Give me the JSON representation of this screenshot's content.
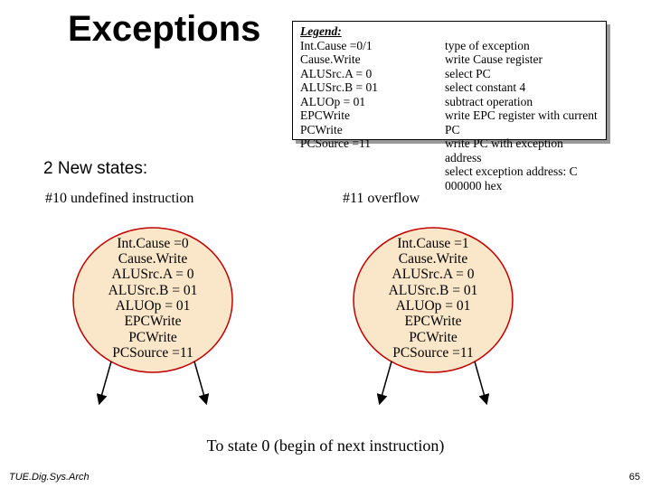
{
  "title": "Exceptions",
  "legend": {
    "heading": "Legend:",
    "items": [
      {
        "sig": "Int.Cause =0/1",
        "desc": "type of exception"
      },
      {
        "sig": "Cause.Write",
        "desc": "write Cause register"
      },
      {
        "sig": "ALUSrc.A = 0",
        "desc": "select PC"
      },
      {
        "sig": "ALUSrc.B = 01",
        "desc": "select constant 4"
      },
      {
        "sig": "ALUOp = 01",
        "desc": "subtract operation"
      },
      {
        "sig": "EPCWrite",
        "desc": "write EPC register with current PC"
      },
      {
        "sig": "PCWrite",
        "desc": "write PC with exception address"
      },
      {
        "sig": "PCSource =11",
        "desc": "select exception address: C 000000 hex"
      }
    ]
  },
  "subheader": "2 New states:",
  "states": [
    {
      "label": "#10 undefined instruction",
      "lines": [
        "Int.Cause =0",
        "Cause.Write",
        "ALUSrc.A = 0",
        "ALUSrc.B = 01",
        "ALUOp = 01",
        "EPCWrite",
        "PCWrite",
        "PCSource =11"
      ]
    },
    {
      "label": "#11 overflow",
      "lines": [
        "Int.Cause =1",
        "Cause.Write",
        "ALUSrc.A = 0",
        "ALUSrc.B = 01",
        "ALUOp = 01",
        "EPCWrite",
        "PCWrite",
        "PCSource =11"
      ]
    }
  ],
  "continue_text": "To state 0 (begin of next instruction)",
  "footer": {
    "left": "TUE.Dig.Sys.Arch",
    "right": "65"
  }
}
